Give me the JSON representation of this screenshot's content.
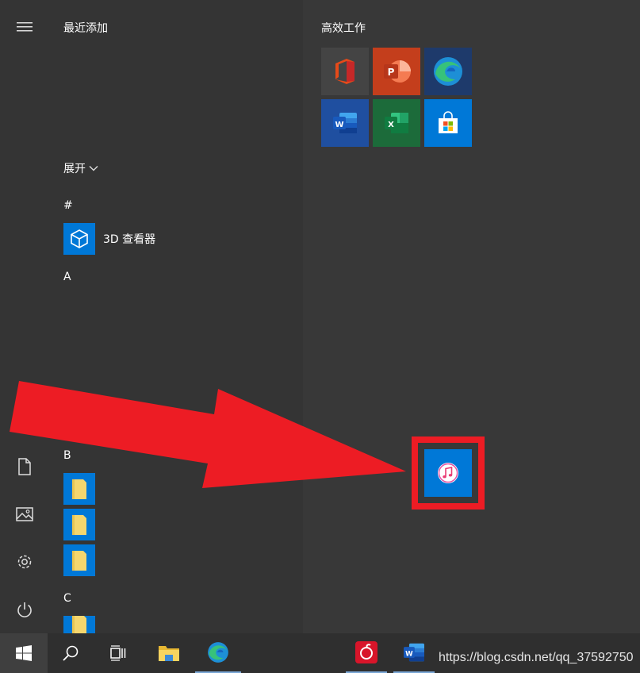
{
  "left_rail": {
    "icons": [
      "hamburger-icon",
      "document-icon",
      "pictures-icon",
      "settings-icon",
      "power-icon"
    ]
  },
  "app_list": {
    "recent_title": "最近添加",
    "expand_label": "展开",
    "groups": [
      {
        "letter": "#",
        "apps": [
          {
            "label": "3D 查看器",
            "icon": "cube-icon"
          }
        ]
      },
      {
        "letter": "A",
        "apps": []
      },
      {
        "letter": "B",
        "apps": [
          {
            "label": "",
            "icon": "folder-icon"
          },
          {
            "label": "",
            "icon": "folder-icon"
          },
          {
            "label": "",
            "icon": "folder-icon"
          }
        ]
      },
      {
        "letter": "C",
        "apps": [
          {
            "label": "",
            "icon": "folder-icon"
          }
        ]
      }
    ]
  },
  "tiles": {
    "group_title": "高效工作",
    "items": [
      {
        "name": "Office",
        "icon": "office-icon",
        "bg": "#444444"
      },
      {
        "name": "PowerPoint",
        "icon": "powerpoint-icon",
        "bg": "#c43e1c"
      },
      {
        "name": "Microsoft Edge",
        "icon": "edge-icon",
        "bg": "#1e3a6b"
      },
      {
        "name": "Word",
        "icon": "word-icon",
        "bg": "#1f4fa0"
      },
      {
        "name": "Excel",
        "icon": "excel-icon",
        "bg": "#1c6b3a"
      },
      {
        "name": "Microsoft Store",
        "icon": "store-icon",
        "bg": "#0078d7"
      }
    ],
    "dropped_tile": {
      "name": "iTunes",
      "icon": "itunes-icon",
      "bg": "#0078d7"
    }
  },
  "annotation": {
    "arrow_color": "#ed1c24",
    "highlight_color": "#ed1c24"
  },
  "taskbar": {
    "items": [
      "start-icon",
      "search-icon",
      "task-view-icon",
      "file-explorer-icon",
      "edge-icon",
      "netease-music-icon",
      "word-icon"
    ],
    "watermark": "https://blog.csdn.net/qq_37592750"
  }
}
